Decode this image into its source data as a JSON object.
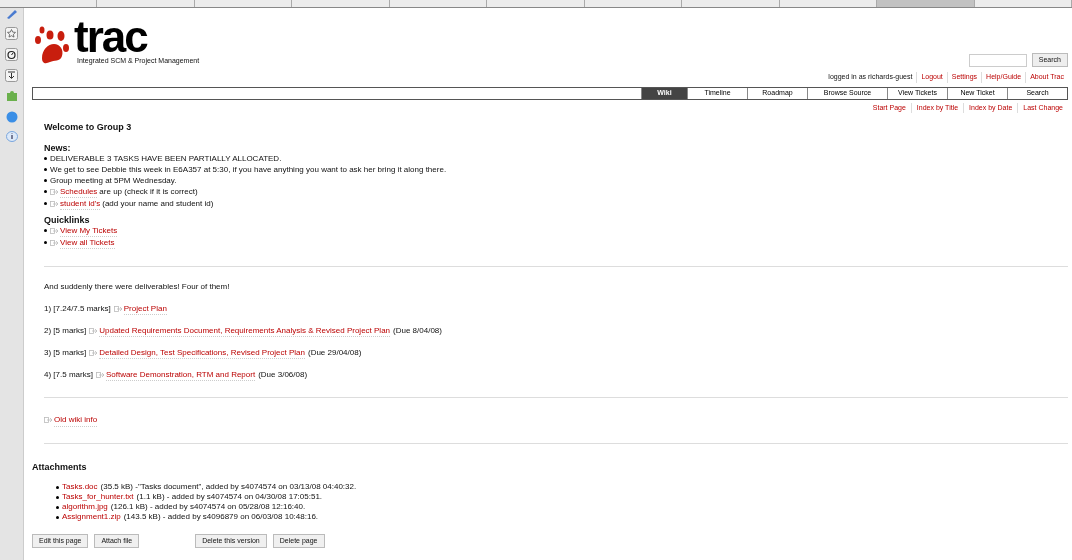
{
  "browser_tabs": [
    {
      "selected": false
    },
    {
      "selected": false
    },
    {
      "selected": false
    },
    {
      "selected": false
    },
    {
      "selected": false
    },
    {
      "selected": false
    },
    {
      "selected": false
    },
    {
      "selected": false
    },
    {
      "selected": false
    },
    {
      "selected": true
    },
    {
      "selected": false
    }
  ],
  "header": {
    "logo": "trac",
    "tagline": "Integrated SCM & Project Management",
    "search_button": "Search",
    "logged_in": "logged in as richards-guest",
    "meta_links": [
      "Logout",
      "Settings",
      "Help/Guide",
      "About Trac"
    ]
  },
  "mainnav": [
    {
      "label": "Wiki",
      "selected": true
    },
    {
      "label": "Timeline",
      "selected": false
    },
    {
      "label": "Roadmap",
      "selected": false
    },
    {
      "label": "Browse Source",
      "selected": false
    },
    {
      "label": "View Tickets",
      "selected": false
    },
    {
      "label": "New Ticket",
      "selected": false
    },
    {
      "label": "Search",
      "selected": false
    }
  ],
  "ctxnav": [
    "Start Page",
    "Index by Title",
    "Index by Date",
    "Last Change"
  ],
  "wiki": {
    "title": "Welcome to Group 3",
    "news_heading": "News:",
    "news": [
      {
        "text": "DELIVERABLE 3 TASKS HAVE BEEN PARTIALLY ALLOCATED."
      },
      {
        "text": "We get to see Debbie this week in E6A357 at 5:30, if you have anything you want to ask her bring it along there."
      },
      {
        "text": "Group meeting at 5PM Wednesday."
      },
      {
        "link": "Schedules",
        "text": "are up (check if it is correct)"
      },
      {
        "link": "student id's",
        "text": "(add your name and student id)"
      }
    ],
    "quicklinks_heading": "Quicklinks",
    "quicklinks": [
      "View My Tickets",
      "View all Tickets"
    ],
    "intro": "And suddenly there were deliverables! Four of them!",
    "deliverables": [
      {
        "prefix": "1) [7.24/7.5 marks]",
        "link": "Project Plan"
      },
      {
        "prefix": "2) [5 marks]",
        "link": "Updated Requirements Document, Requirements Analysis & Revised Project Plan",
        "suffix": "(Due 8/04/08)"
      },
      {
        "prefix": "3) [5 marks]",
        "link": "Detailed Design, Test Specifications, Revised Project Plan",
        "suffix": "(Due 29/04/08)"
      },
      {
        "prefix": "4) [7.5 marks]",
        "link": "Software Demonstration, RTM and Report",
        "suffix": "(Due 3/06/08)"
      }
    ],
    "old_link": "Old wiki info"
  },
  "attachments": {
    "heading": "Attachments",
    "items": [
      {
        "name": "Tasks.doc",
        "details": "(35.5 kB) -\"Tasks document\", added by s4074574 on 03/13/08 04:40:32."
      },
      {
        "name": "Tasks_for_hunter.txt",
        "details": "(1.1 kB) - added by s4074574 on 04/30/08 17:05:51."
      },
      {
        "name": "algorithm.jpg",
        "details": "(126.1 kB) - added by s4074574 on 05/28/08 12:16:40."
      },
      {
        "name": "Assignment1.zip",
        "details": "(143.5 kB) - added by s4096879 on 06/03/08 10:48:16."
      }
    ]
  },
  "buttons": [
    [
      "Edit this page",
      "Attach file"
    ],
    [
      "Delete this version",
      "Delete page"
    ]
  ]
}
